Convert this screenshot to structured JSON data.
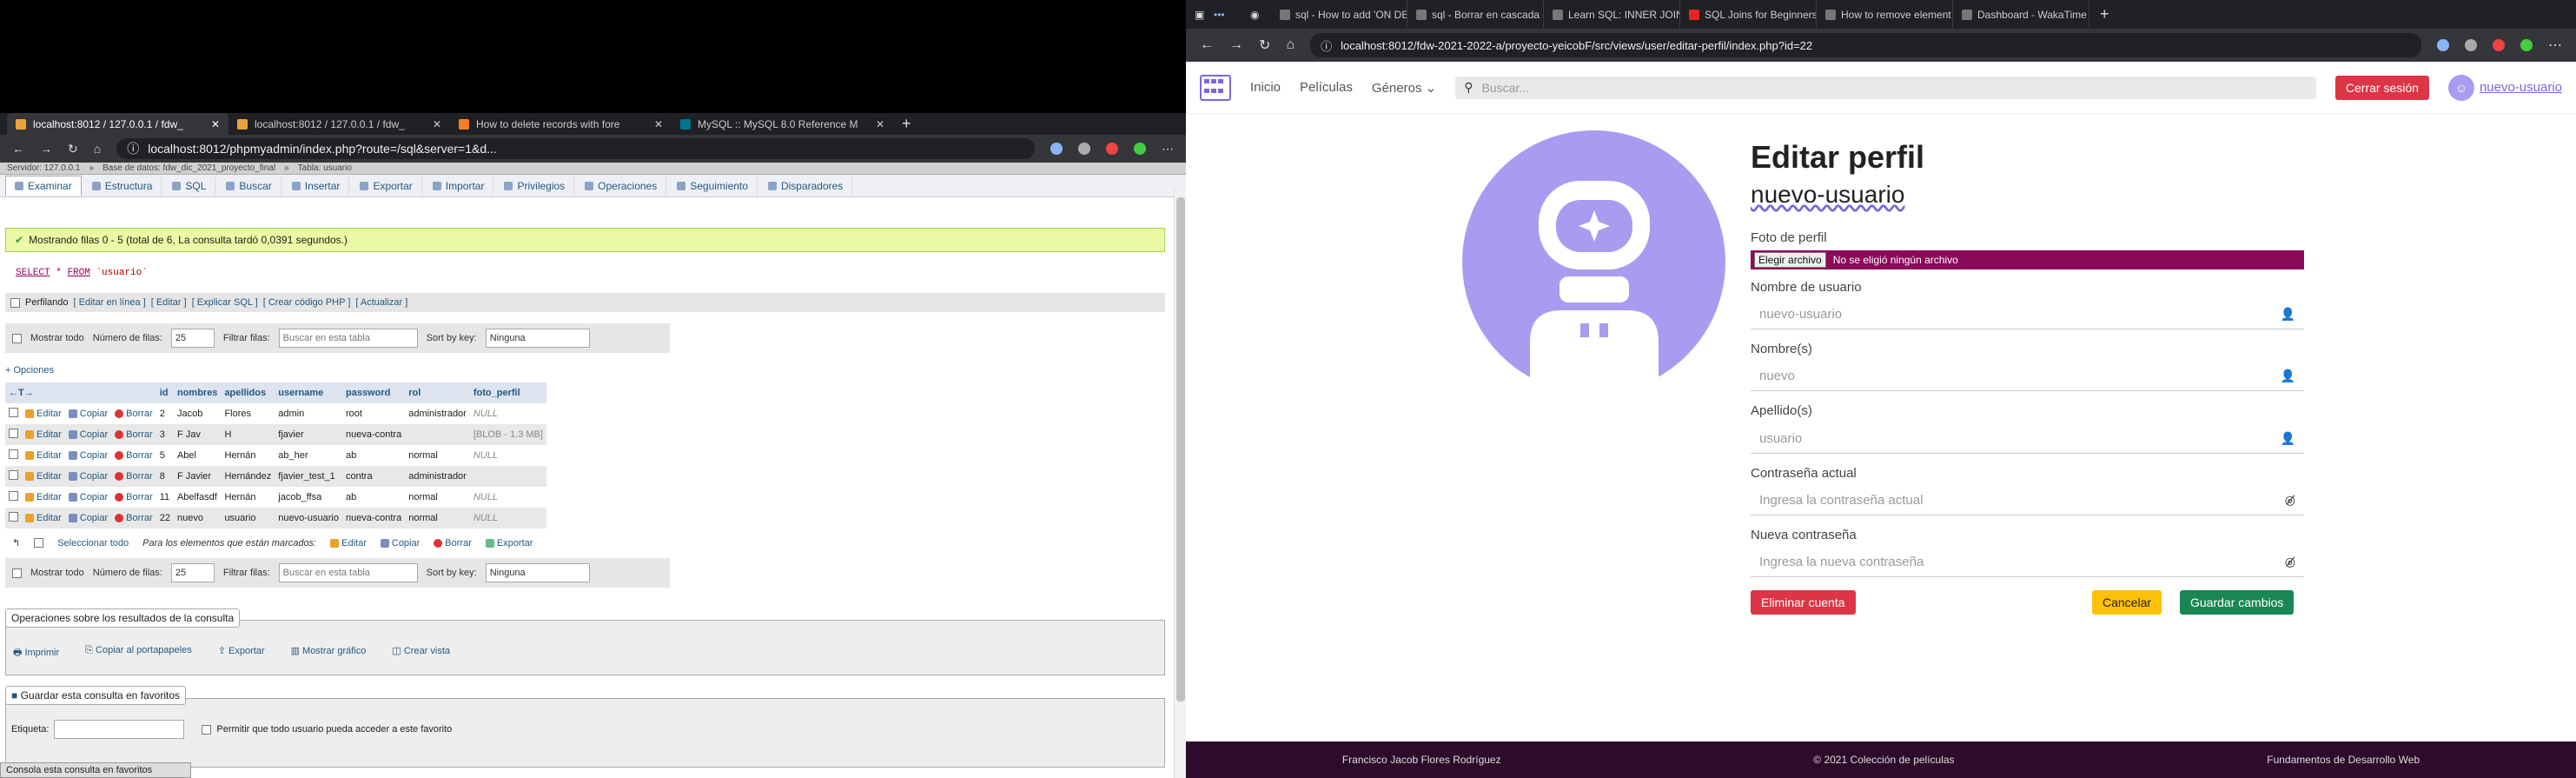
{
  "left": {
    "tabs": [
      {
        "title": "localhost:8012 / 127.0.0.1 / fdw_"
      },
      {
        "title": "localhost:8012 / 127.0.0.1 / fdw_"
      },
      {
        "title": "How to delete records with fore"
      },
      {
        "title": "MySQL :: MySQL 8.0 Reference M"
      }
    ],
    "url": "localhost:8012/phpmyadmin/index.php?route=/sql&server=1&d...",
    "breadcrumb": [
      "Servidor: 127.0.0.1",
      "Base de datos: fdw_dic_2021_proyecto_final",
      "Tabla: usuario"
    ],
    "pma_tabs": [
      "Examinar",
      "Estructura",
      "SQL",
      "Buscar",
      "Insertar",
      "Exportar",
      "Importar",
      "Privilegios",
      "Operaciones",
      "Seguimiento",
      "Disparadores"
    ],
    "success_message": "Mostrando filas 0 - 5 (total de 6, La consulta tardó 0,0391 segundos.)",
    "sql": {
      "kw1": "SELECT",
      "star": "*",
      "kw2": "FROM",
      "table": "`usuario`"
    },
    "profiling": {
      "label": "Perfilando",
      "links": [
        "[ Editar en línea ]",
        "[ Editar ]",
        "[ Explicar SQL ]",
        "[ Crear código PHP ]",
        "[ Actualizar ]"
      ]
    },
    "controls": {
      "show_all": "Mostrar todo",
      "rows_label": "Número de filas:",
      "rows_value": "25",
      "filter_label": "Filtrar filas:",
      "filter_placeholder": "Buscar en esta tabla",
      "sort_label": "Sort by key:",
      "sort_value": "Ninguna"
    },
    "options_link": "+ Opciones",
    "columns": [
      "id",
      "nombres",
      "apellidos",
      "username",
      "password",
      "rol",
      "foto_perfil"
    ],
    "row_actions": {
      "edit": "Editar",
      "copy": "Copiar",
      "delete": "Borrar"
    },
    "rows": [
      {
        "id": "2",
        "nombres": "Jacob",
        "apellidos": "Flores",
        "username": "admin",
        "password": "root",
        "rol": "administrador",
        "foto": "NULL"
      },
      {
        "id": "3",
        "nombres": "F Jav",
        "apellidos": "H",
        "username": "fjavier",
        "password": "nueva-contra",
        "rol": "",
        "foto": "[BLOB - 1.3 MB]"
      },
      {
        "id": "5",
        "nombres": "Abel",
        "apellidos": "Hernán",
        "username": "ab_her",
        "password": "ab",
        "rol": "normal",
        "foto": "NULL"
      },
      {
        "id": "8",
        "nombres": "F Javier",
        "apellidos": "Hernández",
        "username": "fjavier_test_1",
        "password": "contra",
        "rol": "administrador",
        "foto": ""
      },
      {
        "id": "11",
        "nombres": "Abelfasdf",
        "apellidos": "Hernán",
        "username": "jacob_ffsa",
        "password": "ab",
        "rol": "normal",
        "foto": "NULL"
      },
      {
        "id": "22",
        "nombres": "nuevo",
        "apellidos": "usuario",
        "username": "nuevo-usuario",
        "password": "nueva-contra",
        "rol": "normal",
        "foto": "NULL"
      }
    ],
    "bulk": {
      "select_all": "Seleccionar todo",
      "marked": "Para los elementos que están marcados:",
      "edit": "Editar",
      "copy": "Copiar",
      "delete": "Borrar",
      "export": "Exportar"
    },
    "ops_title": "Operaciones sobre los resultados de la consulta",
    "ops": [
      "Imprimir",
      "Copiar al portapapeles",
      "Exportar",
      "Mostrar gráfico",
      "Crear vista"
    ],
    "fav_title": "Guardar esta consulta en favoritos",
    "fav_label": "Etiqueta:",
    "fav_check": "Permitir que todo usuario pueda acceder a este favorito",
    "consola": "Consola",
    "fav_bottom": "esta consulta en favoritos"
  },
  "right": {
    "tabs": [
      "sql - How to add 'ON DE",
      "sql - Borrar en cascada en",
      "Learn SQL: INNER JOIN vs",
      "SQL Joins for Beginners w",
      "How to remove element f",
      "Dashboard - WakaTime"
    ],
    "url": "localhost:8012/fdw-2021-2022-a/proyecto-yeicobF/src/views/user/editar-perfil/index.php?id=22",
    "nav": {
      "home": "Inicio",
      "movies": "Películas",
      "genres": "Géneros",
      "search_placeholder": "Buscar...",
      "logout": "Cerrar sesión",
      "user": "nuevo-usuario"
    },
    "page_title": "Editar perfil",
    "username_heading": "nuevo-usuario",
    "photo_label": "Foto de perfil",
    "file_button": "Elegir archivo",
    "file_status": "No se eligió ningún archivo",
    "fields": [
      {
        "label": "Nombre de usuario",
        "placeholder": "nuevo-usuario",
        "icon": "user-icon"
      },
      {
        "label": "Nombre(s)",
        "placeholder": "nuevo",
        "icon": "user-icon"
      },
      {
        "label": "Apellido(s)",
        "placeholder": "usuario",
        "icon": "user-icon"
      },
      {
        "label": "Contraseña actual",
        "placeholder": "Ingresa la contraseña actual",
        "icon": "eye-slash-icon"
      },
      {
        "label": "Nueva contraseña",
        "placeholder": "Ingresa la nueva contraseña",
        "icon": "eye-slash-icon"
      }
    ],
    "delete_button": "Eliminar cuenta",
    "cancel_button": "Cancelar",
    "save_button": "Guardar cambios",
    "footer": [
      "Francisco Jacob Flores Rodríguez",
      "© 2021 Colección de películas",
      "Fundamentos de Desarrollo Web"
    ],
    "colors": {
      "accent": "#a99cf0",
      "danger": "#dc3545",
      "warning": "#ffc107",
      "success": "#198754",
      "footer": "#2e0a2b",
      "file": "#8b0a5a"
    }
  }
}
